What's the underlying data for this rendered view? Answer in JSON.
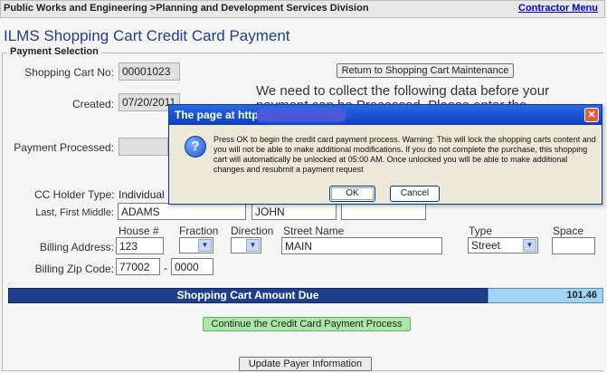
{
  "header": {
    "breadcrumb": "Public Works and Engineering >Planning and Development Services Division",
    "contractor_menu": "Contractor Menu"
  },
  "page_title": "ILMS Shopping Cart Credit Card Payment",
  "section": {
    "legend": "Payment Selection"
  },
  "cart": {
    "cart_no_label": "Shopping Cart No:",
    "cart_no_value": "00001023",
    "created_label": "Created:",
    "created_value": "07/20/2011",
    "processed_label": "Payment Processed:",
    "return_button": "Return to Shopping Cart Maintenance"
  },
  "message": {
    "line1": "We need to collect the following data before your",
    "line2": "payment can be Processed. Please enter the"
  },
  "payer": {
    "holder_type_label": "CC Holder Type:",
    "holder_type_value": "Individual",
    "name_label": "Last, First Middle:",
    "last_name": "ADAMS",
    "first_name": "JOHN",
    "middle_name": ""
  },
  "address": {
    "col_house": "House #",
    "col_fraction": "Fraction",
    "col_direction": "Direction",
    "col_street": "Street Name",
    "col_type": "Type",
    "col_space": "Space",
    "billing_label": "Billing Address:",
    "house_no": "123",
    "fraction": "",
    "direction": "",
    "street_name": "MAIN",
    "street_type": "Street",
    "space": "",
    "zip_label": "Billing Zip Code:",
    "zip": "77002",
    "zip_sep": "-",
    "zip4": "0000"
  },
  "amount": {
    "label": "Shopping Cart Amount Due",
    "value": "101.46"
  },
  "buttons": {
    "continue": "Continue the Credit Card Payment Process",
    "update_payer": "Update Payer Information"
  },
  "dialog": {
    "title": "The page at http:",
    "close": "✕",
    "icon": "?",
    "message": "Press OK to begin the credit card payment process.  Warning: This will lock the shopping carts content and you will not be able to make additional modifications.  If you do not complete the purchase, this shopping cart will automatically be unlocked at 05:00 AM.  Once unlocked you will be able to make additional changes and resubmit a payment request",
    "ok": "OK",
    "cancel": "Cancel"
  },
  "colors": {
    "title_blue": "#1f3d8f",
    "amount_bar": "#1e3f8a",
    "amount_box": "#9fd4f2",
    "continue_green": "#a9e9a6",
    "dialog_titlebar": "#0a3fbf"
  }
}
